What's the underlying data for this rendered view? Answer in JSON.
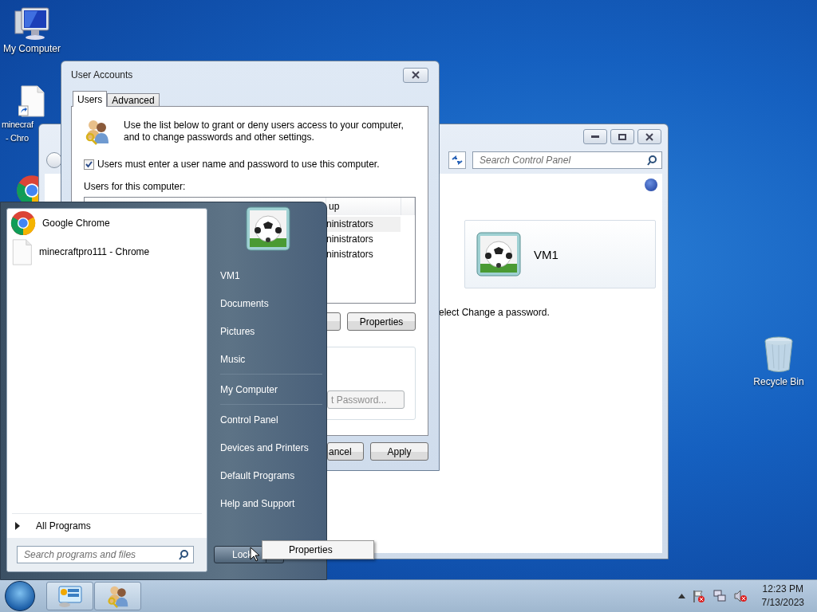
{
  "desktop_icons": [
    {
      "kind": "computer",
      "label_lines": [
        "My Computer"
      ]
    },
    {
      "kind": "shortcut_file",
      "label_lines": [
        "minecraf",
        "- Chro"
      ]
    },
    {
      "kind": "chrome"
    }
  ],
  "recycle_bin": {
    "label": "Recycle Bin"
  },
  "control_panel": {
    "search": {
      "placeholder": "Search Control Panel"
    },
    "user_card": {
      "name": "VM1"
    },
    "instruction": "elect Change a password."
  },
  "user_accounts": {
    "title": "User Accounts",
    "tabs": [
      {
        "label": "Users",
        "selected": true
      },
      {
        "label": "Advanced",
        "selected": false
      }
    ],
    "description_lines": [
      "Use the list below to grant or deny users access to your computer,",
      "and to change passwords and other settings."
    ],
    "require_password": {
      "label": "Users must enter a user name and password to use this computer.",
      "checked": true
    },
    "users_label": "Users for this computer:",
    "users_list": {
      "column_2": "up",
      "rows": [
        {
          "column_2": "ninistrators",
          "selected": true
        },
        {
          "column_2": "ninistrators",
          "selected": false
        },
        {
          "column_2": "ninistrators",
          "selected": false
        }
      ]
    },
    "list_button": "Properties",
    "password_button": {
      "label": "t Password...",
      "disabled": true
    },
    "footer_buttons": [
      "ancel",
      "Apply"
    ]
  },
  "start_menu": {
    "pinned": [
      {
        "kind": "chrome",
        "label": "Google Chrome"
      },
      {
        "kind": "file",
        "label": "minecraftpro111 - Chrome"
      }
    ],
    "all_programs": "All Programs",
    "search": {
      "placeholder": "Search programs and files"
    },
    "places": [
      {
        "label": "VM1",
        "divider_after": false
      },
      {
        "label": "Documents",
        "divider_after": false
      },
      {
        "label": "Pictures",
        "divider_after": false
      },
      {
        "label": "Music",
        "divider_after": true
      },
      {
        "label": "My Computer",
        "divider_after": true
      },
      {
        "label": "Control Panel",
        "divider_after": false
      },
      {
        "label": "Devices and Printers",
        "divider_after": false
      },
      {
        "label": "Default Programs",
        "divider_after": false
      },
      {
        "label": "Help and Support",
        "divider_after": false
      }
    ],
    "power_button": "Lock",
    "context_menu": [
      "Properties"
    ]
  },
  "taskbar": {
    "buttons": [
      {
        "kind": "control_panel"
      },
      {
        "kind": "users"
      }
    ],
    "time": "12:23 PM",
    "date": "7/13/2023"
  }
}
